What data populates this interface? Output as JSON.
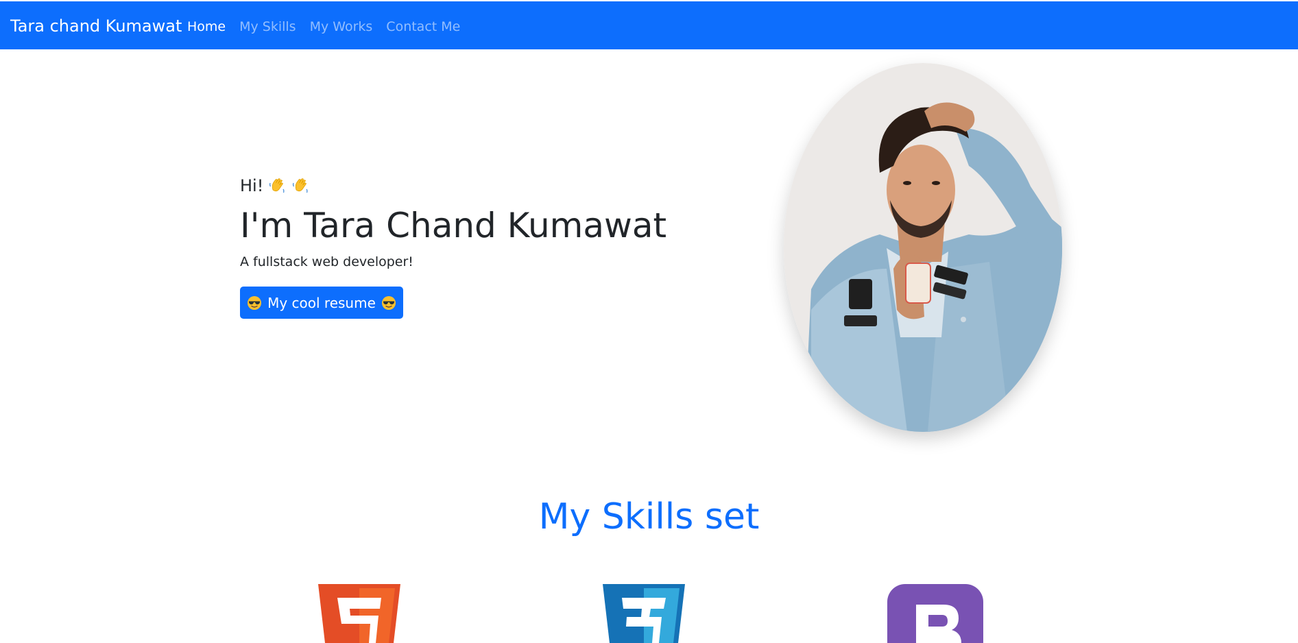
{
  "navbar": {
    "brand": "Tara chand Kumawat",
    "links": [
      {
        "label": "Home",
        "active": true
      },
      {
        "label": "My Skills",
        "active": false
      },
      {
        "label": "My Works",
        "active": false
      },
      {
        "label": "Contact Me",
        "active": false
      }
    ],
    "background_color": "#0d6efd"
  },
  "hero": {
    "greeting": "Hi!",
    "headline": "I'm Tara Chand Kumawat",
    "tagline": "A fullstack web developer!",
    "resume_button_label": "My cool resume",
    "greeting_icons": [
      "waving-hand-icon",
      "waving-hand-icon"
    ],
    "button_icons": [
      "sunglasses-face-icon",
      "sunglasses-face-icon"
    ]
  },
  "skills": {
    "title": "My Skills set",
    "title_color": "#0d6efd",
    "logos": [
      {
        "icon": "html5-logo-icon",
        "color": "#e44d26"
      },
      {
        "icon": "css3-logo-icon",
        "color": "#1572b6"
      },
      {
        "icon": "bootstrap-logo-icon",
        "color": "#7952b3"
      }
    ]
  }
}
